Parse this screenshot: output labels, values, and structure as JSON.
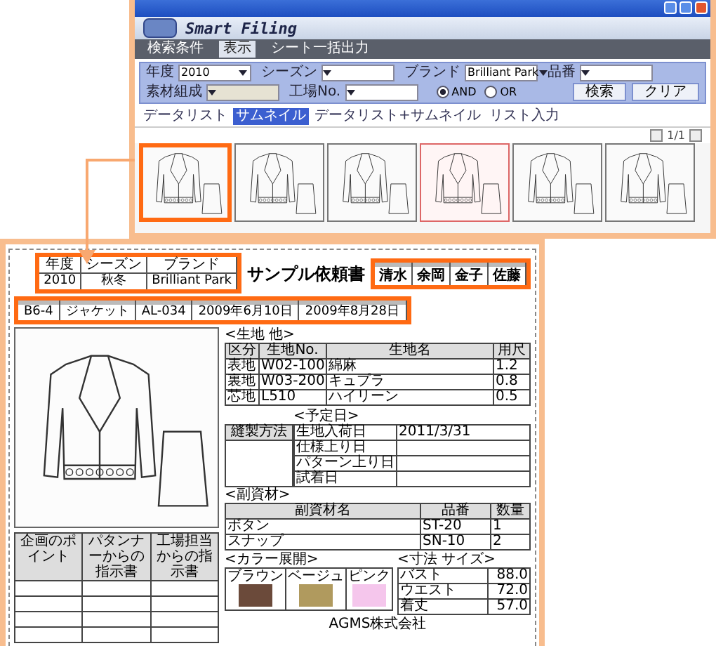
{
  "app_window": {
    "logo_text": "Smart Filing",
    "menu": [
      {
        "label": "検索条件",
        "selected": false
      },
      {
        "label": "表示",
        "selected": true
      },
      {
        "label": "シート一括出力",
        "selected": false
      }
    ],
    "search_fields": [
      {
        "label": "年度",
        "value": "2010",
        "disabled": false
      },
      {
        "label": "シーズン",
        "disabled": false
      },
      {
        "label": "ブランド",
        "value": "Brilliant Park",
        "disabled": false
      },
      {
        "label": "品番",
        "disabled": false
      },
      {
        "label": "素材組成",
        "disabled": true
      },
      {
        "label": "工場No.",
        "disabled": false
      }
    ],
    "match_options": [
      {
        "label": "AND",
        "selected": true
      },
      {
        "label": "OR",
        "selected": false
      }
    ],
    "buttons": [
      "検索",
      "クリア"
    ],
    "tabs": [
      {
        "label": "データリスト",
        "selected": false
      },
      {
        "label": "サムネイル",
        "selected": true
      },
      {
        "label": "データリスト+サムネイル",
        "selected": false
      },
      {
        "label": "リスト入力",
        "selected": false
      }
    ],
    "pager": "1/1",
    "thumbnails": [
      {
        "highlighted": true,
        "selected": false
      },
      {
        "highlighted": false,
        "selected": false
      },
      {
        "highlighted": false,
        "selected": false
      },
      {
        "highlighted": false,
        "selected": true
      },
      {
        "highlighted": false,
        "selected": false
      },
      {
        "highlighted": false,
        "selected": false
      }
    ]
  },
  "sheet": {
    "header_fields": [
      {
        "label": "年度",
        "value": "2010"
      },
      {
        "label": "シーズン",
        "value": "秋冬"
      },
      {
        "label": "ブランド",
        "value": "Brilliant Park"
      }
    ],
    "title": "サンプル依頼書",
    "approvers": [
      "清水",
      "余岡",
      "金子",
      "佐藤"
    ],
    "info_values": [
      "B6-4",
      "ジャケット",
      "AL-034",
      "2009年6月10日",
      "2009年8月28日"
    ],
    "instruction_columns": [
      "企画のポイント",
      "パタンナーからの指示書",
      "工場担当からの指示書"
    ],
    "materials": {
      "title": "<生地 他>",
      "columns": [
        "区分",
        "生地No.",
        "生地名",
        "用尺"
      ],
      "rows": [
        [
          "表地",
          "W02-100",
          "綿麻",
          "1.2"
        ],
        [
          "裏地",
          "W03-200",
          "キュプラ",
          "0.8"
        ],
        [
          "芯地",
          "L510",
          "ハイリーン",
          "0.5"
        ]
      ]
    },
    "schedule": {
      "title": "<予定日>",
      "method_label": "縫製方法",
      "rows": [
        [
          "生地入荷日",
          "2011/3/31"
        ],
        [
          "仕様上り日"
        ],
        [
          "パターン上り日"
        ],
        [
          "試着日"
        ]
      ]
    },
    "accessories": {
      "title": "<副資材>",
      "columns": [
        "副資材名",
        "品番",
        "数量"
      ],
      "rows": [
        [
          "ボタン",
          "ST-20",
          "1"
        ],
        [
          "スナップ",
          "SN-10",
          "2"
        ]
      ]
    },
    "colors": {
      "title": "<カラー展開>",
      "items": [
        {
          "name": "ブラウン",
          "color": "#6b4a3a"
        },
        {
          "name": "ベージュ",
          "color": "#b09a5e"
        },
        {
          "name": "ピンク",
          "color": "#f5c6ec"
        }
      ]
    },
    "sizes": {
      "title": "<寸法 サイズ>",
      "rows": [
        [
          "バスト",
          "88.0"
        ],
        [
          "ウエスト",
          "72.0"
        ],
        [
          "着丈",
          "57.0"
        ]
      ]
    },
    "company": "AGMS株式会社"
  }
}
